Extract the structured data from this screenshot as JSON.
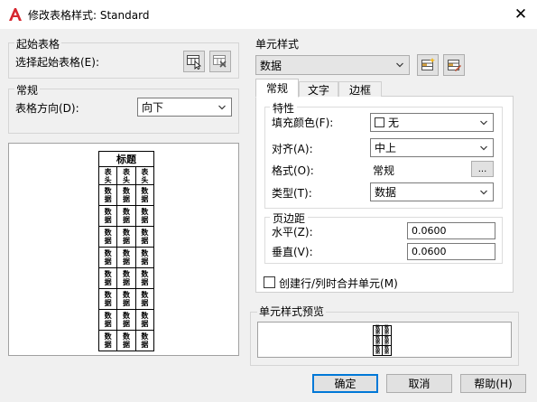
{
  "window": {
    "title": "修改表格样式: Standard",
    "close": "✕"
  },
  "start_table": {
    "group_title": "起始表格",
    "select_label": "选择起始表格(E):"
  },
  "general": {
    "group_title": "常规",
    "direction_label": "表格方向(D):",
    "direction_value": "向下"
  },
  "cell_style": {
    "group_title": "单元样式",
    "selected": "数据",
    "tabs": [
      "常规",
      "文字",
      "边框"
    ],
    "properties": {
      "group_title": "特性",
      "fill_label": "填充颜色(F):",
      "fill_value": "无",
      "align_label": "对齐(A):",
      "align_value": "中上",
      "format_label": "格式(O):",
      "format_value": "常规",
      "format_button": "...",
      "type_label": "类型(T):",
      "type_value": "数据"
    },
    "margins": {
      "group_title": "页边距",
      "horizontal_label": "水平(Z):",
      "horizontal_value": "0.0600",
      "vertical_label": "垂直(V):",
      "vertical_value": "0.0600"
    },
    "merge_checkbox_label": "创建行/列时合并单元(M)",
    "merge_checked": false
  },
  "cell_preview": {
    "group_title": "单元样式预览"
  },
  "table_preview": {
    "title": "标题",
    "header_cell": "表头",
    "data_cell": "数据",
    "data_rows": 8,
    "columns": 3
  },
  "buttons": {
    "ok": "确定",
    "cancel": "取消",
    "help": "帮助(H)"
  },
  "colors": {
    "accent": "#0078d7",
    "logo_red": "#d6262f"
  }
}
